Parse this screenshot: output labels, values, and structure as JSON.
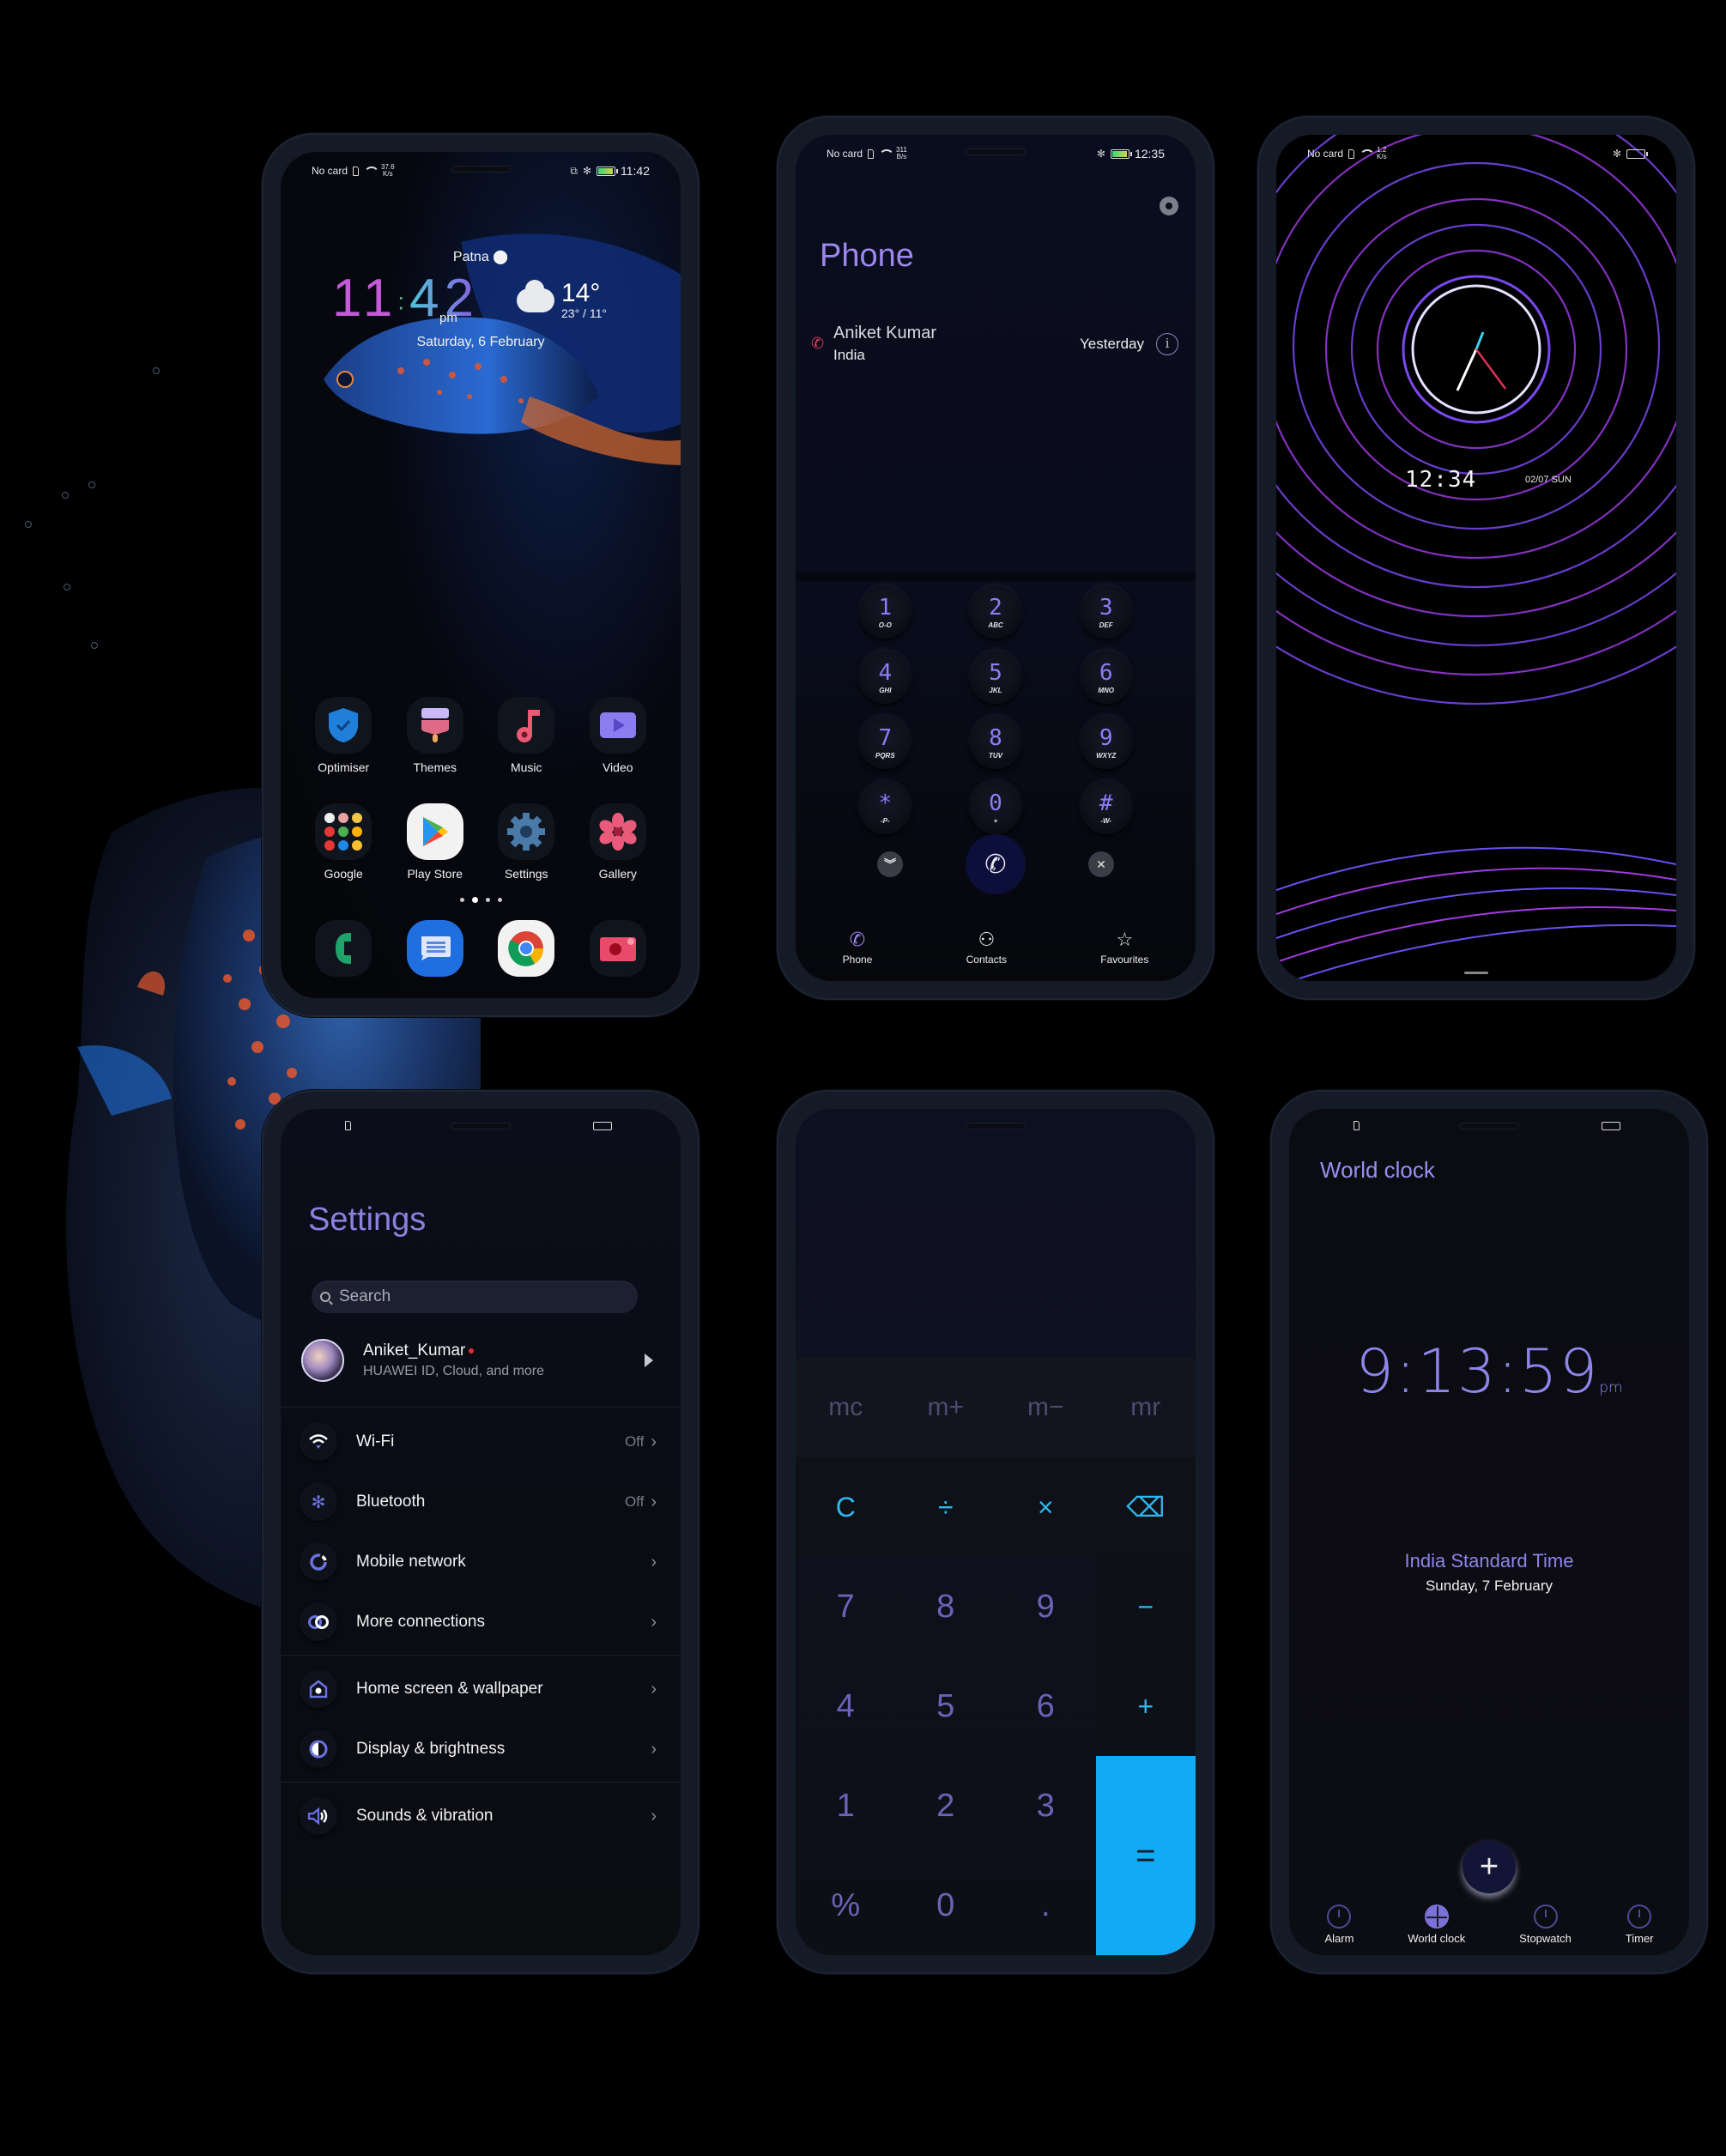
{
  "theme": {
    "accent_purple": "#9d86ee",
    "accent_cyan": "#2fb7ee",
    "equals_blue": "#13aaf5",
    "missed_call_red": "#e0435a",
    "background": "#000000"
  },
  "home_screen": {
    "status": {
      "carrier": "No card",
      "rate_top": "37.6",
      "rate_bottom": "K/s",
      "time": "11:42"
    },
    "location": "Patna",
    "clock": {
      "hours": "11",
      "minutes": "42",
      "ampm": "pm"
    },
    "weather": {
      "current": "14°",
      "high_low": "23° / 11°",
      "icon": "cloud-wind-icon"
    },
    "date": "Saturday, 6 February",
    "apps": [
      {
        "label": "Optimiser",
        "icon": "shield-check-icon"
      },
      {
        "label": "Themes",
        "icon": "paintbrush-icon"
      },
      {
        "label": "Music",
        "icon": "music-note-icon"
      },
      {
        "label": "Video",
        "icon": "video-play-icon"
      },
      {
        "label": "Google",
        "icon": "google-folder-icon"
      },
      {
        "label": "Play Store",
        "icon": "play-store-icon"
      },
      {
        "label": "Settings",
        "icon": "gear-icon"
      },
      {
        "label": "Gallery",
        "icon": "flower-icon"
      }
    ],
    "page_count": 4,
    "active_page": 2,
    "dock": [
      {
        "name": "phone",
        "icon": "phone-icon"
      },
      {
        "name": "messages",
        "icon": "message-icon"
      },
      {
        "name": "chrome",
        "icon": "chrome-icon"
      },
      {
        "name": "camera",
        "icon": "camera-icon"
      }
    ]
  },
  "phone_app": {
    "status": {
      "carrier": "No card",
      "rate_top": "311",
      "rate_bottom": "B/s",
      "time": "12:35"
    },
    "title": "Phone",
    "recent_calls": [
      {
        "name": "Aniket Kumar",
        "location": "India",
        "when": "Yesterday",
        "type": "outgoing"
      }
    ],
    "keys": [
      {
        "digit": "1",
        "letters": "O-O"
      },
      {
        "digit": "2",
        "letters": "ABC"
      },
      {
        "digit": "3",
        "letters": "DEF"
      },
      {
        "digit": "4",
        "letters": "GHI"
      },
      {
        "digit": "5",
        "letters": "JKL"
      },
      {
        "digit": "6",
        "letters": "MNO"
      },
      {
        "digit": "7",
        "letters": "PQRS"
      },
      {
        "digit": "8",
        "letters": "TUV"
      },
      {
        "digit": "9",
        "letters": "WXYZ"
      },
      {
        "digit": "*",
        "letters": "-P-"
      },
      {
        "digit": "0",
        "letters": "+"
      },
      {
        "digit": "#",
        "letters": "-W-"
      }
    ],
    "tabs": [
      {
        "label": "Phone",
        "icon": "phone-icon",
        "active": true
      },
      {
        "label": "Contacts",
        "icon": "contacts-icon",
        "active": false
      },
      {
        "label": "Favourites",
        "icon": "star-icon",
        "active": false
      }
    ]
  },
  "always_on_display": {
    "status": {
      "carrier": "No card",
      "rate_top": "1.2",
      "rate_bottom": "K/s"
    },
    "digital_time": "12:34",
    "date": "02/07 SUN"
  },
  "settings": {
    "title": "Settings",
    "search_placeholder": "Search",
    "account": {
      "name": "Aniket_Kumar",
      "subtitle": "HUAWEI ID, Cloud, and more"
    },
    "items": [
      {
        "label": "Wi-Fi",
        "value": "Off",
        "icon": "wifi-icon"
      },
      {
        "label": "Bluetooth",
        "value": "Off",
        "icon": "bluetooth-icon"
      },
      {
        "label": "Mobile network",
        "value": "",
        "icon": "mobile-network-icon"
      },
      {
        "label": "More connections",
        "value": "",
        "icon": "link-icon"
      },
      {
        "label": "Home screen & wallpaper",
        "value": "",
        "icon": "home-gear-icon"
      },
      {
        "label": "Display & brightness",
        "value": "",
        "icon": "contrast-icon"
      },
      {
        "label": "Sounds & vibration",
        "value": "",
        "icon": "speaker-icon"
      }
    ]
  },
  "calculator": {
    "memory_keys": [
      "mc",
      "m+",
      "m−",
      "mr"
    ],
    "keys": [
      [
        "C",
        "÷",
        "×",
        "⌫"
      ],
      [
        "7",
        "8",
        "9",
        "−"
      ],
      [
        "4",
        "5",
        "6",
        "+"
      ],
      [
        "1",
        "2",
        "3",
        "="
      ],
      [
        "%",
        "0",
        "."
      ]
    ]
  },
  "world_clock": {
    "title": "World clock",
    "time": "9:13:59",
    "ampm": "pm",
    "zone": "India Standard Time",
    "date": "Sunday, 7 February",
    "add_label": "+",
    "tabs": [
      {
        "label": "Alarm",
        "icon": "alarm-icon",
        "active": false
      },
      {
        "label": "World clock",
        "icon": "globe-icon",
        "active": true
      },
      {
        "label": "Stopwatch",
        "icon": "stopwatch-icon",
        "active": false
      },
      {
        "label": "Timer",
        "icon": "timer-icon",
        "active": false
      }
    ]
  }
}
